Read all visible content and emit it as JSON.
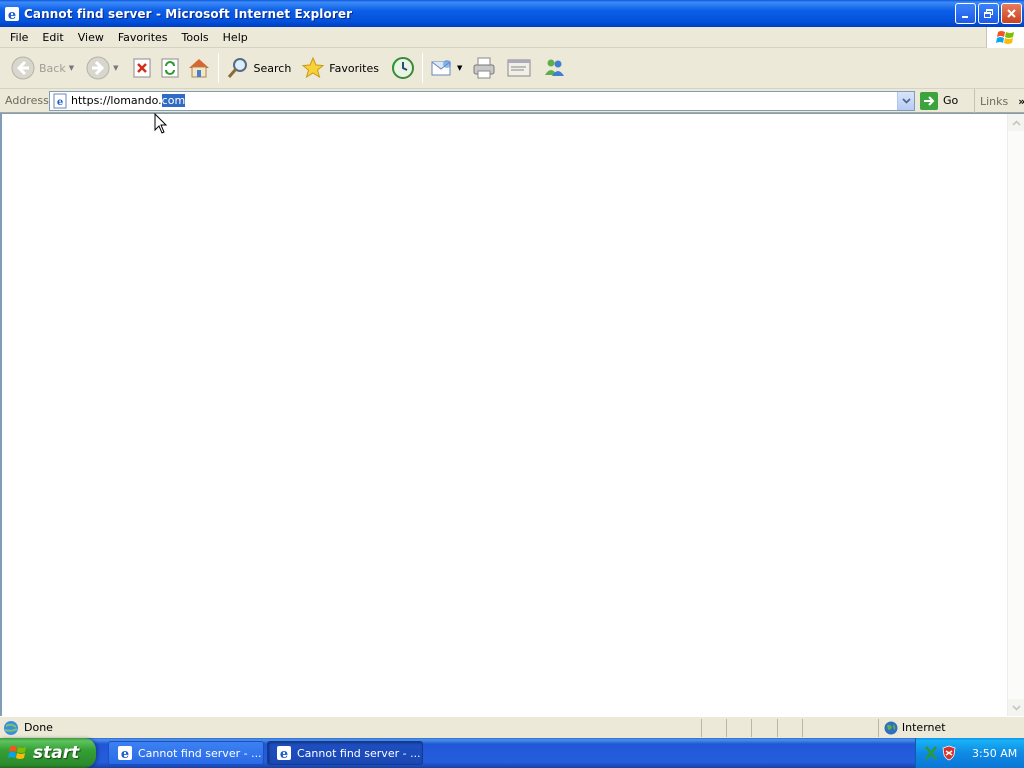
{
  "window": {
    "title": "Cannot find server - Microsoft Internet Explorer"
  },
  "menu": {
    "items": [
      "File",
      "Edit",
      "View",
      "Favorites",
      "Tools",
      "Help"
    ]
  },
  "toolbar": {
    "back_label": "Back",
    "search_label": "Search",
    "favorites_label": "Favorites"
  },
  "address_bar": {
    "label": "Address",
    "url_unselected": "https://lomando.",
    "url_selected": "com",
    "go_label": "Go",
    "links_label": "Links"
  },
  "status_bar": {
    "status_text": "Done",
    "zone_text": "Internet"
  },
  "taskbar": {
    "start_label": "start",
    "tasks": [
      {
        "label": "Cannot find server - ..."
      },
      {
        "label": "Cannot find server - ..."
      }
    ],
    "clock": "3:50 AM"
  },
  "colors": {
    "titlebar_blue": "#0b5ee9",
    "chrome_beige": "#ece9d8",
    "selection_blue": "#316ac5",
    "start_green": "#35a035"
  }
}
